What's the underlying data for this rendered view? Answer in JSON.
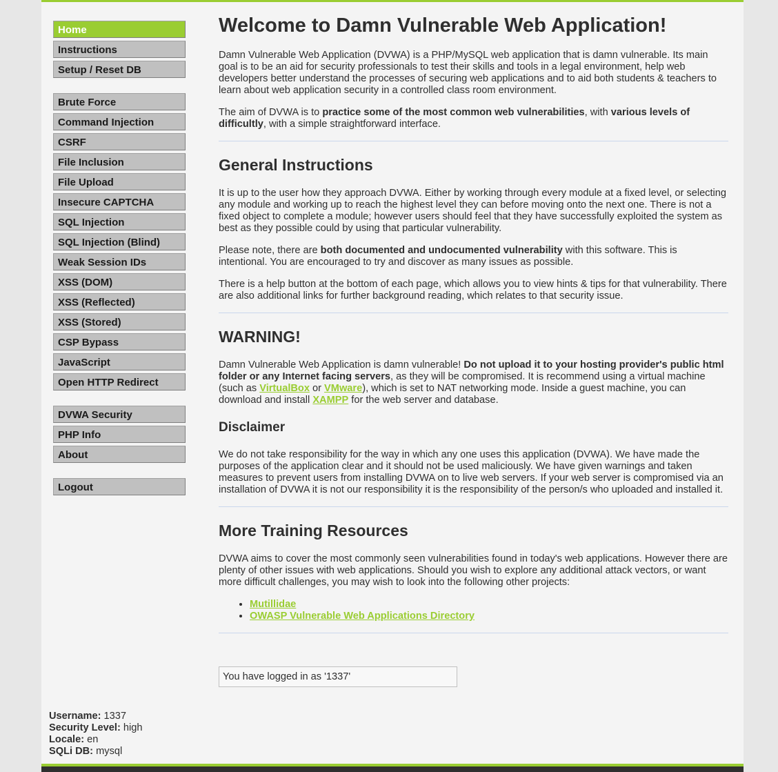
{
  "menu": {
    "block1": [
      "Home",
      "Instructions",
      "Setup / Reset DB"
    ],
    "block2": [
      "Brute Force",
      "Command Injection",
      "CSRF",
      "File Inclusion",
      "File Upload",
      "Insecure CAPTCHA",
      "SQL Injection",
      "SQL Injection (Blind)",
      "Weak Session IDs",
      "XSS (DOM)",
      "XSS (Reflected)",
      "XSS (Stored)",
      "CSP Bypass",
      "JavaScript",
      "Open HTTP Redirect"
    ],
    "block3": [
      "DVWA Security",
      "PHP Info",
      "About"
    ],
    "block4": [
      "Logout"
    ],
    "selected": "Home",
    "selected_color": "#9acd32"
  },
  "main": {
    "title": "Welcome to Damn Vulnerable Web Application!",
    "intro_p1": "Damn Vulnerable Web Application (DVWA) is a PHP/MySQL web application that is damn vulnerable. Its main goal is to be an aid for security professionals to test their skills and tools in a legal environment, help web developers better understand the processes of securing web applications and to aid both students & teachers to learn about web application security in a controlled class room environment.",
    "intro_p2_a": "The aim of DVWA is to ",
    "intro_p2_b": "practice some of the most common web vulnerabilities",
    "intro_p2_c": ", with ",
    "intro_p2_d": "various levels of difficultly",
    "intro_p2_e": ", with a simple straightforward interface.",
    "general_heading": "General Instructions",
    "general_p1": "It is up to the user how they approach DVWA. Either by working through every module at a fixed level, or selecting any module and working up to reach the highest level they can before moving onto the next one. There is not a fixed object to complete a module; however users should feel that they have successfully exploited the system as best as they possible could by using that particular vulnerability.",
    "general_p2_a": "Please note, there are ",
    "general_p2_b": "both documented and undocumented vulnerability",
    "general_p2_c": " with this software. This is intentional. You are encouraged to try and discover as many issues as possible.",
    "general_p3": "There is a help button at the bottom of each page, which allows you to view hints & tips for that vulnerability. There are also additional links for further background reading, which relates to that security issue.",
    "warning_heading": "WARNING!",
    "warning_a": "Damn Vulnerable Web Application is damn vulnerable! ",
    "warning_b": "Do not upload it to your hosting provider's public html folder or any Internet facing servers",
    "warning_c": ", as they will be compromised. It is recommend using a virtual machine (such as ",
    "warning_link1": "VirtualBox",
    "warning_d": " or ",
    "warning_link2": "VMware",
    "warning_e": "), which is set to NAT networking mode. Inside a guest machine, you can download and install ",
    "warning_link3": "XAMPP",
    "warning_f": " for the web server and database.",
    "disclaimer_heading": "Disclaimer",
    "disclaimer_p": "We do not take responsibility for the way in which any one uses this application (DVWA). We have made the purposes of the application clear and it should not be used maliciously. We have given warnings and taken measures to prevent users from installing DVWA on to live web servers. If your web server is compromised via an installation of DVWA it is not our responsibility it is the responsibility of the person/s who uploaded and installed it.",
    "training_heading": "More Training Resources",
    "training_p": "DVWA aims to cover the most commonly seen vulnerabilities found in today's web applications. However there are plenty of other issues with web applications. Should you wish to explore any additional attack vectors, or want more difficult challenges, you may wish to look into the following other projects:",
    "resources": [
      "Mutillidae",
      "OWASP Vulnerable Web Applications Directory"
    ]
  },
  "logged_in_message": "You have logged in as '1337'",
  "system_info": {
    "username_label": "Username:",
    "username": "1337",
    "security_label": "Security Level:",
    "security": "high",
    "locale_label": "Locale:",
    "locale": "en",
    "sqli_label": "SQLi DB:",
    "sqli": "mysql"
  },
  "colors": {
    "accent": "#9acd32",
    "footer": "#2f2f2f"
  }
}
